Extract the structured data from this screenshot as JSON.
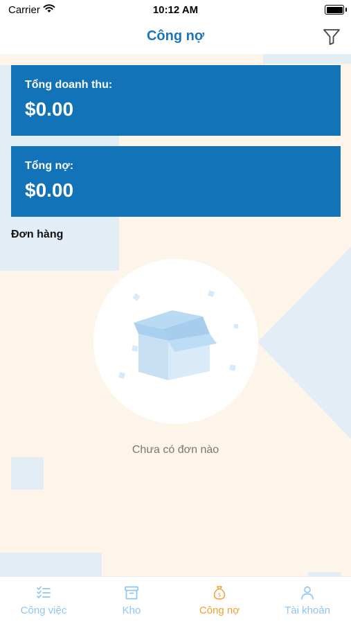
{
  "status_bar": {
    "carrier": "Carrier",
    "time": "10:12 AM"
  },
  "header": {
    "title": "Công nợ",
    "filter_icon": "filter-icon"
  },
  "summary": {
    "revenue": {
      "label": "Tổng doanh thu:",
      "value": "$0.00"
    },
    "debt": {
      "label": "Tổng nợ:",
      "value": "$0.00"
    }
  },
  "orders": {
    "section_title": "Đơn hàng",
    "empty_message": "Chưa có đơn nào",
    "empty_icon": "empty-box-icon"
  },
  "tabs": [
    {
      "label": "Công việc",
      "icon": "task-list-icon",
      "active": false
    },
    {
      "label": "Kho",
      "icon": "archive-box-icon",
      "active": false
    },
    {
      "label": "Công nợ",
      "icon": "money-bag-icon",
      "active": true
    },
    {
      "label": "Tài khoản",
      "icon": "person-icon",
      "active": false
    }
  ],
  "colors": {
    "accent_blue": "#1a75bb",
    "card_blue": "#1273b9",
    "active_tab": "#f0a030",
    "inactive_tab": "#8fc6ee",
    "background": "#fdf5ea"
  }
}
